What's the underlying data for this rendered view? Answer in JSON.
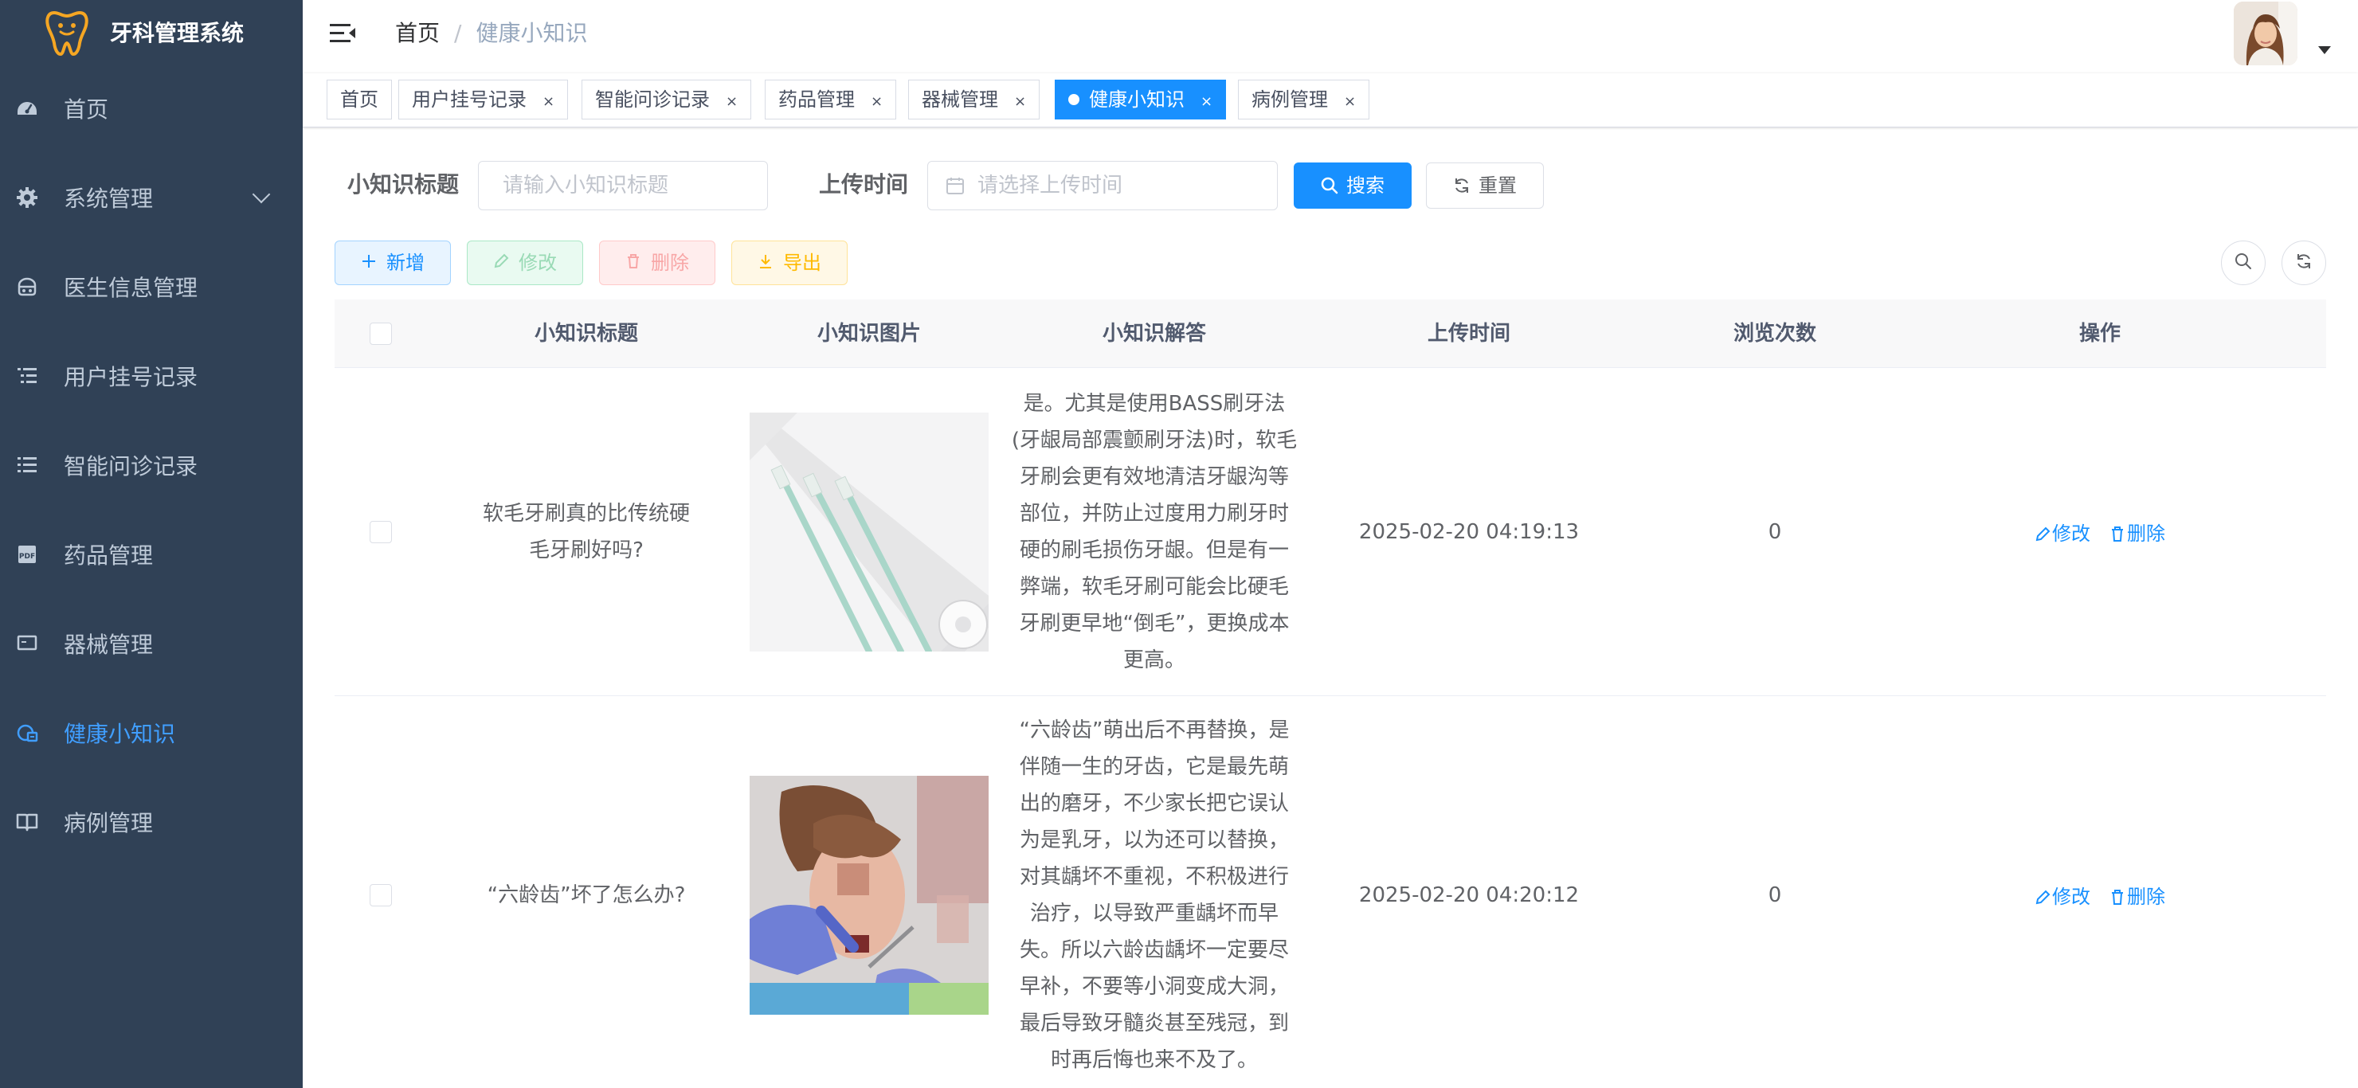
{
  "sidebar": {
    "title": "牙科管理系统",
    "items": [
      {
        "label": "首页",
        "icon": "dashboard-icon"
      },
      {
        "label": "系统管理",
        "icon": "gear-icon"
      },
      {
        "label": "医生信息管理",
        "icon": "doctor-icon"
      },
      {
        "label": "用户挂号记录",
        "icon": "list-icon"
      },
      {
        "label": "智能问诊记录",
        "icon": "list-icon"
      },
      {
        "label": "药品管理",
        "icon": "pdf-icon"
      },
      {
        "label": "器械管理",
        "icon": "monitor-icon"
      },
      {
        "label": "健康小知识",
        "icon": "knowledge-icon"
      },
      {
        "label": "病例管理",
        "icon": "book-icon"
      }
    ],
    "active_index": 7
  },
  "navbar": {
    "breadcrumb": [
      "首页",
      "健康小知识"
    ],
    "breadcrumb_sep": "/"
  },
  "tags": [
    {
      "label": "首页",
      "closable": false
    },
    {
      "label": "用户挂号记录",
      "closable": true
    },
    {
      "label": "智能问诊记录",
      "closable": true
    },
    {
      "label": "药品管理",
      "closable": true
    },
    {
      "label": "器械管理",
      "closable": true
    },
    {
      "label": "健康小知识",
      "closable": true,
      "active": true
    },
    {
      "label": "病例管理",
      "closable": true
    }
  ],
  "tag_close": "×",
  "search": {
    "title_label": "小知识标题",
    "title_placeholder": "请输入小知识标题",
    "time_label": "上传时间",
    "time_placeholder": "请选择上传时间",
    "search_btn": "搜索",
    "reset_btn": "重置"
  },
  "toolbar": {
    "add": "新增",
    "edit": "修改",
    "delete": "删除",
    "export": "导出"
  },
  "table": {
    "columns": [
      "小知识标题",
      "小知识图片",
      "小知识解答",
      "上传时间",
      "浏览次数",
      "操作"
    ],
    "rows": [
      {
        "title": "软毛牙刷真的比传统硬毛牙刷好吗?",
        "image": "toothbrushes-image",
        "answer": "是。尤其是使用BASS刷牙法(牙龈局部震颤刷牙法)时，软毛牙刷会更有效地清洁牙龈沟等部位，并防止过度用力刷牙时硬的刷毛损伤牙龈。但是有一弊端，软毛牙刷可能会比硬毛牙刷更早地“倒毛”，更换成本更高。",
        "time": "2025-02-20 04:19:13",
        "views": "0"
      },
      {
        "title": "“六龄齿”坏了怎么办?",
        "image": "child-dental-exam-image",
        "answer": "“六龄齿”萌出后不再替换，是伴随一生的牙齿，它是最先萌出的磨牙，不少家长把它误认为是乳牙，以为还可以替换，对其龋坏不重视，不积极进行治疗，以导致严重龋坏而早失。所以六龄齿龋坏一定要尽早补，不要等小洞变成大洞，最后导致牙髓炎甚至残冠，到时再后悔也来不及了。",
        "time": "2025-02-20 04:20:12",
        "views": "0"
      }
    ],
    "op_edit": "修改",
    "op_delete": "删除"
  },
  "colors": {
    "sidebar_bg": "#304156",
    "sidebar_text": "#bfcbd9",
    "active": "#409eff",
    "primary": "#1890ff",
    "logo": "#f5a623"
  }
}
